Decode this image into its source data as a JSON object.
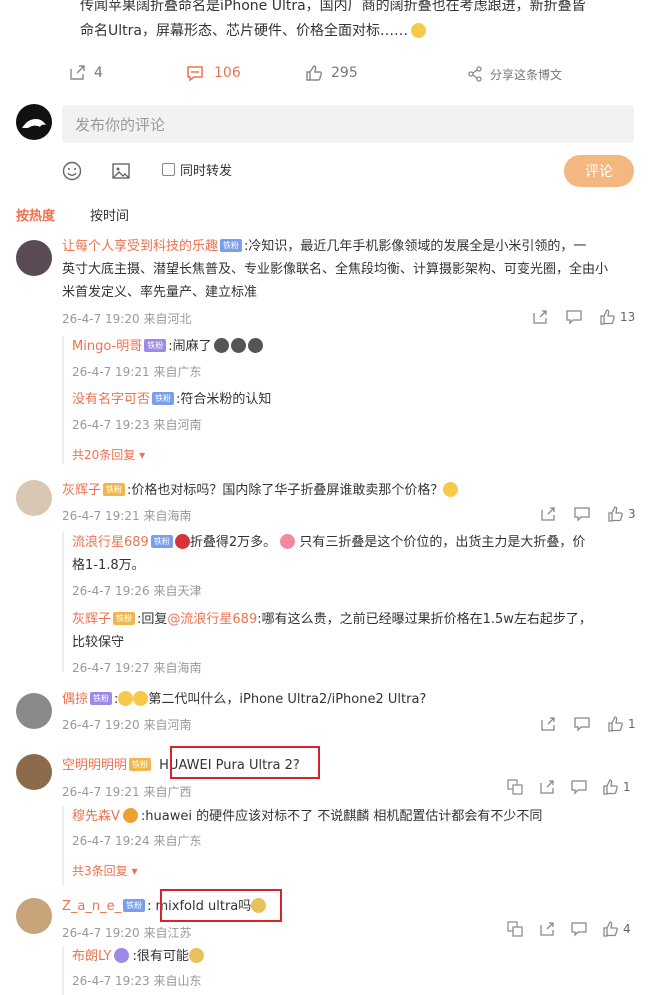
{
  "post": {
    "text_line1": "传闻苹果阔折叠命名是iPhone Ultra，国内厂商的阔折叠也在考虑跟进，新折叠皆",
    "text_line2": "命名Ultra，屏幕形态、芯片硬件、价格全面对标……",
    "share_count": "4",
    "comment_count": "106",
    "like_count": "295",
    "share_poster_label": "分享这条博文"
  },
  "composer": {
    "placeholder": "发布你的评论",
    "repost_label": "同时转发",
    "submit_label": "评论"
  },
  "sort": {
    "hot_label": "按热度",
    "time_label": "按时间"
  },
  "comments": [
    {
      "name": "让每个人享受到科技的乐趣",
      "badge": "铁粉",
      "text1": ":冷知识，最近几年手机影像领域的发展全是小米引领的，一",
      "text2": "英寸大底主摄、潜望长焦普及、专业影像联名、全焦段均衡、计算摄影架构、可变光圈，全由小",
      "text3": "米首发定义、率先量产、建立标准",
      "time": "26-4-7 19:20",
      "loc": "来自河北",
      "likes": "13",
      "replies": [
        {
          "name": "Mingo-明哥",
          "badge": "铁粉",
          "text": ":闹麻了",
          "time": "26-4-7 19:21",
          "loc": "来自广东"
        },
        {
          "name": "没有名字可否",
          "badge": "铁粉",
          "text": ":符合米粉的认知",
          "time": "26-4-7 19:23",
          "loc": "来自河南"
        }
      ],
      "more": "共20条回复"
    },
    {
      "name": "灰辉子",
      "badge": "铁粉",
      "text1": ":价格也对标吗？国内除了华子折叠屏谁敢卖那个价格？",
      "time": "26-4-7 19:21",
      "loc": "来自海南",
      "likes": "3",
      "replies": [
        {
          "name": "流浪行星689",
          "badge": "铁粉",
          "text": "折叠得2万多。",
          "text_b": "只有三折叠是这个价位的，出货主力是大折叠，价",
          "text2": "格1-1.8万。",
          "time": "26-4-7 19:26",
          "loc": "来自天津"
        },
        {
          "name": "灰辉子",
          "badge": "铁粉",
          "text": ":回复",
          "mention": "@流浪行星689",
          "text_b": ":哪有这么贵，之前已经曝过果折价格在1.5w左右起步了，",
          "text2": "比较保守",
          "time": "26-4-7 19:27",
          "loc": "来自海南"
        }
      ]
    },
    {
      "name": "偶掠",
      "badge": "铁粉",
      "text1": "第二代叫什么，iPhone Ultra2/iPhone2 Ultra?",
      "time": "26-4-7 19:20",
      "loc": "来自河南",
      "likes": "1"
    },
    {
      "name": "空明明明明",
      "badge": "铁粉",
      "text1": "HUAWEI Pura Ultra 2?",
      "time": "26-4-7 19:21",
      "loc": "来自广西",
      "likes": "1",
      "replies": [
        {
          "name": "穆先森V",
          "text": ":huawei 的硬件应该对标不了 不说麒麟 相机配置估计都会有不少不同",
          "time": "26-4-7 19:24",
          "loc": "来自广东"
        }
      ],
      "more": "共3条回复"
    },
    {
      "name": "Z_a_n_e_",
      "badge": "铁粉",
      "text1": "mixfold ultra吗",
      "time": "26-4-7 19:20",
      "loc": "来自江苏",
      "likes": "4",
      "replies": [
        {
          "name": "布朗LY",
          "text": ":很有可能",
          "time": "26-4-7 19:23",
          "loc": "来自山东"
        }
      ]
    }
  ]
}
